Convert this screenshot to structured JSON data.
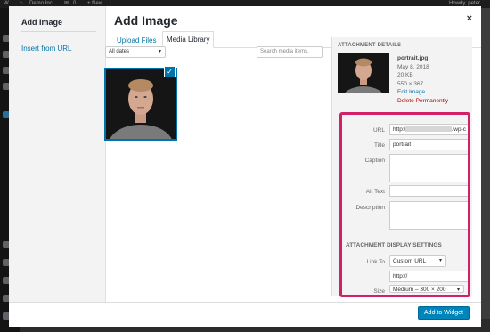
{
  "admin_bar": {
    "site_name": "Demo Inc",
    "comments_count": "0",
    "new_label": "+ New",
    "greeting": "Howdy, peter"
  },
  "modal": {
    "left_menu_title": "Add Image",
    "insert_from_url": "Insert from URL",
    "title": "Add Image",
    "close_glyph": "×",
    "tabs": [
      {
        "label": "Upload Files",
        "active": false
      },
      {
        "label": "Media Library",
        "active": true
      }
    ],
    "filter_dates": "All dates",
    "search_placeholder": "Search media items.",
    "attachment_selected": true,
    "check_glyph": "✓"
  },
  "details": {
    "heading": "ATTACHMENT DETAILS",
    "filename": "portrait.jpg",
    "date": "May 8, 2018",
    "size": "20 KB",
    "dimensions": "550 × 367",
    "edit_image": "Edit Image",
    "delete_permanently": "Delete Permanently",
    "fields": {
      "url_label": "URL",
      "url_prefix": "http:/",
      "url_suffix": "/wp-c",
      "title_label": "Title",
      "title_value": "portrait",
      "caption_label": "Caption",
      "caption_value": "",
      "alt_label": "Alt Text",
      "alt_value": "",
      "description_label": "Description",
      "description_value": ""
    }
  },
  "display_settings": {
    "heading": "ATTACHMENT DISPLAY SETTINGS",
    "link_to_label": "Link To",
    "link_to_value": "Custom URL",
    "link_url_value": "http://",
    "size_label": "Size",
    "size_value": "Medium – 300 × 200"
  },
  "footer": {
    "primary_button": "Add to Widget"
  },
  "colors": {
    "accent": "#0073aa",
    "primary_button": "#0085ba",
    "highlight_box": "#d31f66",
    "delete_link": "#aa0000"
  }
}
